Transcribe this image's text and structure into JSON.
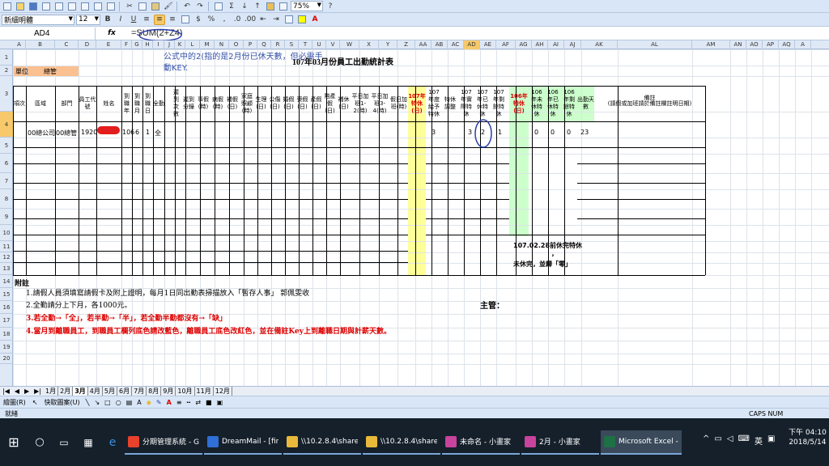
{
  "toolbar": {
    "font_name": "新細明體",
    "font_size": "12",
    "bold": "B",
    "italic": "I",
    "underline": "U",
    "currency": "$",
    "percent": "%",
    "comma": ",",
    "zoom": "75%",
    "sigma": "Σ"
  },
  "formula_bar": {
    "cell_ref": "AD4",
    "fx": "fx",
    "formula": "=SUM(2+Z4)"
  },
  "columns": [
    "A",
    "B",
    "C",
    "D",
    "E",
    "F",
    "G",
    "H",
    "I",
    "J",
    "K",
    "L",
    "M",
    "N",
    "O",
    "P",
    "Q",
    "R",
    "S",
    "T",
    "U",
    "V",
    "W",
    "X",
    "Y",
    "Z",
    "AA",
    "AB",
    "AC",
    "AD",
    "AE",
    "AF",
    "AG",
    "AH",
    "AI",
    "AJ",
    "AK",
    "AL",
    "AM",
    "AN",
    "AO",
    "AP",
    "AQ",
    "A"
  ],
  "rows": [
    "1",
    "2",
    "3",
    "4",
    "5",
    "6",
    "7",
    "8",
    "9",
    "10",
    "11",
    "12",
    "13",
    "14",
    "15",
    "16",
    "17",
    "18",
    "19",
    "20"
  ],
  "sheet": {
    "title": "107年03月份員工出勤統計表",
    "note_line1": "公式中的2(指的是2月份已休天數，但必需手",
    "note_line2": "動KEY.",
    "unit_label": "單位",
    "unit_value": "總管",
    "headers": {
      "item": "項次",
      "region": "區域",
      "dept": "部門",
      "emp_no": "員工代號",
      "name": "姓名",
      "arr_year": "到職年",
      "arr_month": "到職月",
      "arr_day": "到職日",
      "full": "全勤",
      "late_count": "遲到次數",
      "late_min": "遲到分鐘",
      "personal": "事假(時)",
      "sick": "病假(時)",
      "comp": "補假(日)",
      "family": "家庭照顧(時)",
      "menstrual": "生理(日)",
      "injury": "公傷(日)",
      "marriage": "婚假(日)",
      "funeral": "喪假(日)",
      "maternity": "產假(日)",
      "paternity": "陪產假(日)",
      "makeup_leave": "補休(日)",
      "ot1": "平日加班1-2(時)",
      "ot2": "平日加班3-4(時)",
      "holiday_ot": "假日加班(時)",
      "sp107": "107年特休(日)",
      "year_grant": "107年度給予特休",
      "sp_adjust": "特休調整",
      "sp_actual": "107年實際特休",
      "sp_used": "107年已休特休",
      "sp_remain": "107年剩餘特休",
      "sp106": "106年特休(日)",
      "sp106_unused": "106年未休特休",
      "sp106_used": "106年已休特休",
      "sp106_remain": "106年剩餘特休",
      "attend_days": "出勤天數",
      "remarks": "備註",
      "remarks_sub": "(請假或加班請於備註欄註明日期)"
    },
    "row4": {
      "region": "00總公司",
      "dept": "00總管",
      "emp_no": "1920",
      "arr_year": "106",
      "arr_month": "6",
      "arr_day": "1",
      "full": "全",
      "year_grant": "3",
      "sp_actual": "3",
      "sp_used": "2",
      "sp_remain": "1",
      "sp106_unused": "0",
      "sp106_used": "0",
      "sp106_remain": "0",
      "attend_days": "23"
    },
    "box_note_line1": "107.02.28前休完特休",
    "box_note_line2": "，",
    "box_note_line3": "未休完，並歸「零」",
    "notes_title": "附註",
    "note1": "1.請假人員須填寫請假卡及附上證明，每月1日同出勤表掃描放入「暫存人事」   郭佩雯收",
    "note2": "2.全勤請分上下月，各1000元。",
    "note3": "3.若全勤→「全」，若半勤→「半」，若全勤半勤都沒有→「缺」",
    "note4": "4.當月到離職員工，到職員工欄列底色請改藍色，離職員工底色改紅色，並在備註Key上到離職日期與計薪天數。",
    "supervisor": "主管："
  },
  "tabs": [
    "1月",
    "2月",
    "3月",
    "4月",
    "5月",
    "6月",
    "7月",
    "8月",
    "9月",
    "10月",
    "11月",
    "12月"
  ],
  "active_tab": "3月",
  "drawbar": {
    "draw": "繪圖(R)",
    "autoshape": "快取圖案(U)"
  },
  "statusbar": {
    "ready": "就緒",
    "caps": "CAPS NUM"
  },
  "taskbar": {
    "apps": [
      {
        "label": "分期管理系統 - G...",
        "color": "#e8412c"
      },
      {
        "label": "DreamMail - [fin...",
        "color": "#2f6fd6"
      },
      {
        "label": "\\\\10.2.8.4\\share-...",
        "color": "#e8b93a"
      },
      {
        "label": "\\\\10.2.8.4\\share-...",
        "color": "#e8b93a"
      },
      {
        "label": "未命名 - 小畫家",
        "color": "#c8439b"
      },
      {
        "label": "2月 - 小畫家",
        "color": "#c8439b"
      },
      {
        "label": "Microsoft Excel -...",
        "color": "#1e7145"
      }
    ],
    "ime": "英",
    "time": "下午 04:10",
    "date": "2018/5/14"
  }
}
